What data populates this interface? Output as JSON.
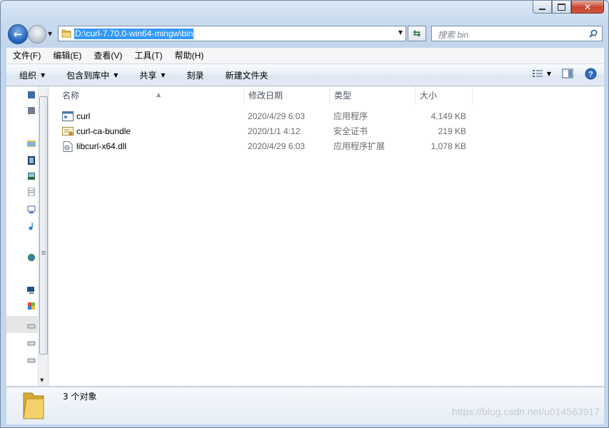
{
  "window": {
    "address_path": "D:\\curl-7.70.0-win64-mingw\\bin",
    "search_placeholder": "搜索 bin"
  },
  "menu": [
    "文件(F)",
    "编辑(E)",
    "查看(V)",
    "工具(T)",
    "帮助(H)"
  ],
  "toolbar": {
    "organize": "组织",
    "include_library": "包含到库中",
    "share": "共享",
    "burn": "刻录",
    "new_folder": "新建文件夹"
  },
  "columns": {
    "name": "名称",
    "date": "修改日期",
    "type": "类型",
    "size": "大小"
  },
  "files": [
    {
      "name": "curl",
      "date": "2020/4/29 6:03",
      "type": "应用程序",
      "size": "4,149 KB",
      "icon": "exe-icon"
    },
    {
      "name": "curl-ca-bundle",
      "date": "2020/1/1 4:12",
      "type": "安全证书",
      "size": "219 KB",
      "icon": "certificate-icon"
    },
    {
      "name": "libcurl-x64.dll",
      "date": "2020/4/29 6:03",
      "type": "应用程序扩展",
      "size": "1,078 KB",
      "icon": "dll-icon"
    }
  ],
  "status": {
    "item_count": "3 个对象"
  },
  "watermark": "https://blog.csdn.net/u014563917",
  "colors": {
    "selection": "#3399ff",
    "close_button": "#c7452f"
  }
}
